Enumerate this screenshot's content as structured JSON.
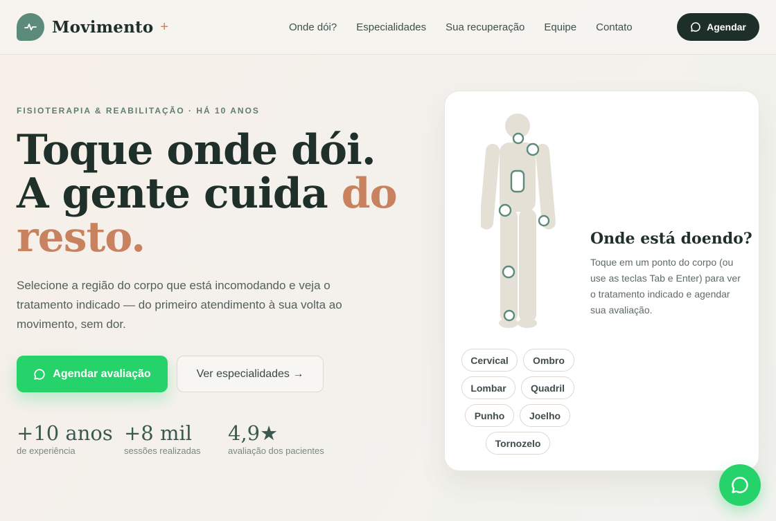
{
  "header": {
    "brand": "Movimento",
    "brand_plus": "+",
    "nav": [
      "Onde dói?",
      "Especialidades",
      "Sua recuperação",
      "Equipe",
      "Contato"
    ],
    "cta": "Agendar"
  },
  "hero": {
    "eyebrow": "FISIOTERAPIA & REABILITAÇÃO · HÁ 10 ANOS",
    "title_line1": "Toque onde dói.",
    "title_line2": "A gente cuida ",
    "title_accent": "do resto.",
    "lead": "Selecione a região do corpo que está incomodando e veja o tratamento indicado — do primeiro atendimento à sua volta ao movimento, sem dor.",
    "primary_cta": "Agendar avaliação",
    "secondary_cta": "Ver especialidades →"
  },
  "stats": [
    {
      "value": "+10 anos",
      "label": "de experiência"
    },
    {
      "value": "+8 mil",
      "label": "sessões realizadas"
    },
    {
      "value": "4,9★",
      "label": "avaliação dos pacientes"
    }
  ],
  "card": {
    "title": "Onde está doendo?",
    "text": "Toque em um ponto do corpo (ou use as teclas Tab e Enter) para ver o tratamento indicado e agendar sua avaliação.",
    "chips": [
      "Cervical",
      "Ombro",
      "Lombar",
      "Quadril",
      "Punho",
      "Joelho",
      "Tornozelo"
    ]
  },
  "colors": {
    "brand": "#5c8a7b",
    "accent": "#c9825f",
    "dark": "#1e2f2a",
    "whatsapp": "#25d36a"
  },
  "icons": {
    "logo": "pulse-icon",
    "chat": "chat-bubble-icon"
  }
}
